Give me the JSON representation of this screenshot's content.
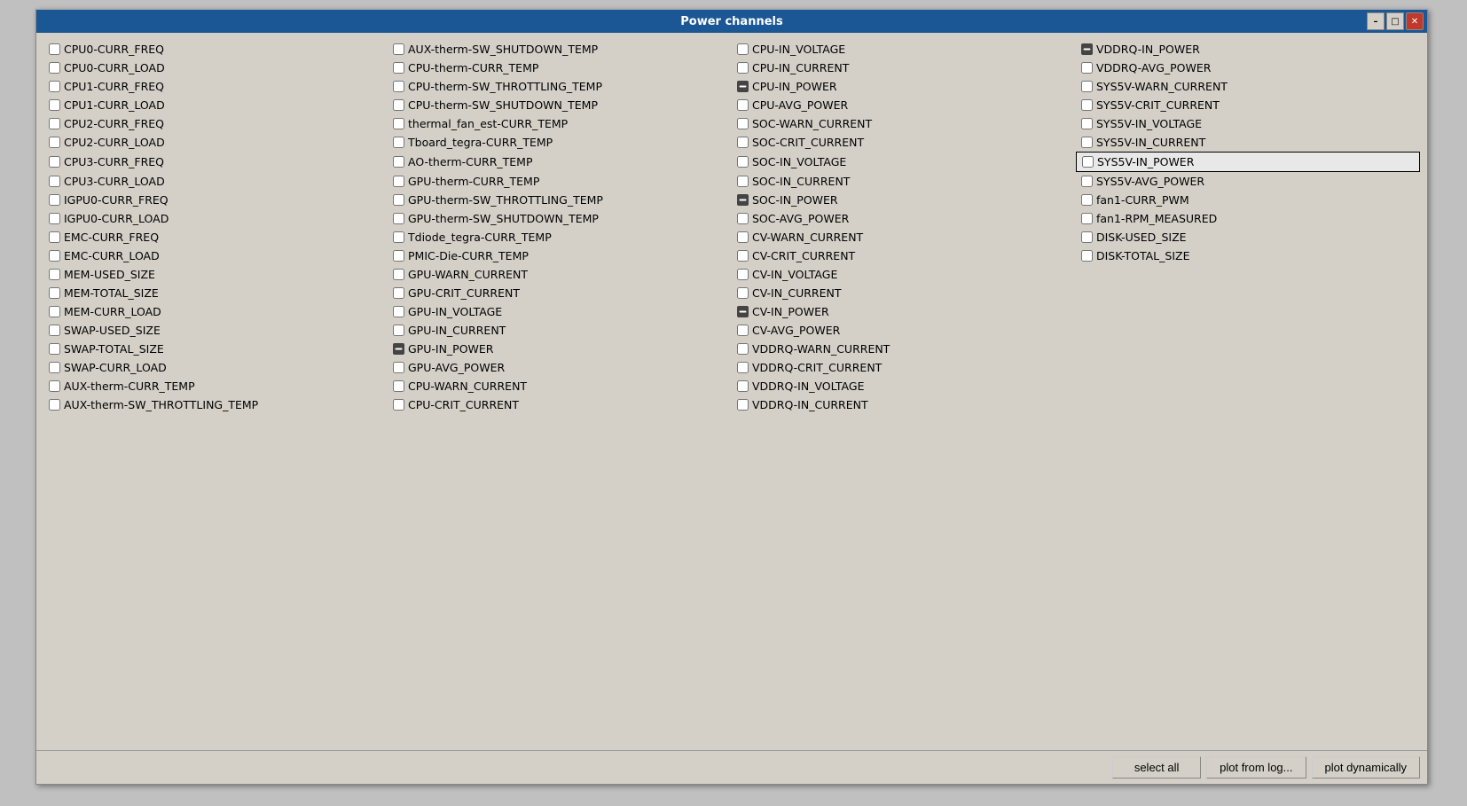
{
  "window": {
    "title": "Power channels",
    "titlebar_buttons": {
      "minimize": "–",
      "maximize": "□",
      "close": "✕"
    }
  },
  "buttons": {
    "select_all": "select all",
    "plot_from_log": "plot from log...",
    "plot_dynamically": "plot dynamically"
  },
  "columns": [
    [
      {
        "label": "CPU0-CURR_FREQ",
        "checked": false,
        "filled": false,
        "selected": false
      },
      {
        "label": "CPU0-CURR_LOAD",
        "checked": false,
        "filled": false,
        "selected": false
      },
      {
        "label": "CPU1-CURR_FREQ",
        "checked": false,
        "filled": false,
        "selected": false
      },
      {
        "label": "CPU1-CURR_LOAD",
        "checked": false,
        "filled": false,
        "selected": false
      },
      {
        "label": "CPU2-CURR_FREQ",
        "checked": false,
        "filled": false,
        "selected": false
      },
      {
        "label": "CPU2-CURR_LOAD",
        "checked": false,
        "filled": false,
        "selected": false
      },
      {
        "label": "CPU3-CURR_FREQ",
        "checked": false,
        "filled": false,
        "selected": false
      },
      {
        "label": "CPU3-CURR_LOAD",
        "checked": false,
        "filled": false,
        "selected": false
      },
      {
        "label": "IGPU0-CURR_FREQ",
        "checked": false,
        "filled": false,
        "selected": false
      },
      {
        "label": "IGPU0-CURR_LOAD",
        "checked": false,
        "filled": false,
        "selected": false
      },
      {
        "label": "EMC-CURR_FREQ",
        "checked": false,
        "filled": false,
        "selected": false
      },
      {
        "label": "EMC-CURR_LOAD",
        "checked": false,
        "filled": false,
        "selected": false
      },
      {
        "label": "MEM-USED_SIZE",
        "checked": false,
        "filled": false,
        "selected": false
      },
      {
        "label": "MEM-TOTAL_SIZE",
        "checked": false,
        "filled": false,
        "selected": false
      },
      {
        "label": "MEM-CURR_LOAD",
        "checked": false,
        "filled": false,
        "selected": false
      },
      {
        "label": "SWAP-USED_SIZE",
        "checked": false,
        "filled": false,
        "selected": false
      },
      {
        "label": "SWAP-TOTAL_SIZE",
        "checked": false,
        "filled": false,
        "selected": false
      },
      {
        "label": "SWAP-CURR_LOAD",
        "checked": false,
        "filled": false,
        "selected": false
      },
      {
        "label": "AUX-therm-CURR_TEMP",
        "checked": false,
        "filled": false,
        "selected": false
      },
      {
        "label": "AUX-therm-SW_THROTTLING_TEMP",
        "checked": false,
        "filled": false,
        "selected": false
      }
    ],
    [
      {
        "label": "AUX-therm-SW_SHUTDOWN_TEMP",
        "checked": false,
        "filled": false,
        "selected": false
      },
      {
        "label": "CPU-therm-CURR_TEMP",
        "checked": false,
        "filled": false,
        "selected": false
      },
      {
        "label": "CPU-therm-SW_THROTTLING_TEMP",
        "checked": false,
        "filled": false,
        "selected": false
      },
      {
        "label": "CPU-therm-SW_SHUTDOWN_TEMP",
        "checked": false,
        "filled": false,
        "selected": false
      },
      {
        "label": "thermal_fan_est-CURR_TEMP",
        "checked": false,
        "filled": false,
        "selected": false
      },
      {
        "label": "Tboard_tegra-CURR_TEMP",
        "checked": false,
        "filled": false,
        "selected": false
      },
      {
        "label": "AO-therm-CURR_TEMP",
        "checked": false,
        "filled": false,
        "selected": false
      },
      {
        "label": "GPU-therm-CURR_TEMP",
        "checked": false,
        "filled": false,
        "selected": false
      },
      {
        "label": "GPU-therm-SW_THROTTLING_TEMP",
        "checked": false,
        "filled": false,
        "selected": false
      },
      {
        "label": "GPU-therm-SW_SHUTDOWN_TEMP",
        "checked": false,
        "filled": false,
        "selected": false
      },
      {
        "label": "Tdiode_tegra-CURR_TEMP",
        "checked": false,
        "filled": false,
        "selected": false
      },
      {
        "label": "PMIC-Die-CURR_TEMP",
        "checked": false,
        "filled": false,
        "selected": false
      },
      {
        "label": "GPU-WARN_CURRENT",
        "checked": false,
        "filled": false,
        "selected": false
      },
      {
        "label": "GPU-CRIT_CURRENT",
        "checked": false,
        "filled": false,
        "selected": false
      },
      {
        "label": "GPU-IN_VOLTAGE",
        "checked": false,
        "filled": false,
        "selected": false
      },
      {
        "label": "GPU-IN_CURRENT",
        "checked": false,
        "filled": false,
        "selected": false
      },
      {
        "label": "GPU-IN_POWER",
        "checked": false,
        "filled": true,
        "selected": false
      },
      {
        "label": "GPU-AVG_POWER",
        "checked": false,
        "filled": false,
        "selected": false
      },
      {
        "label": "CPU-WARN_CURRENT",
        "checked": false,
        "filled": false,
        "selected": false
      },
      {
        "label": "CPU-CRIT_CURRENT",
        "checked": false,
        "filled": false,
        "selected": false
      }
    ],
    [
      {
        "label": "CPU-IN_VOLTAGE",
        "checked": false,
        "filled": false,
        "selected": false
      },
      {
        "label": "CPU-IN_CURRENT",
        "checked": false,
        "filled": false,
        "selected": false
      },
      {
        "label": "CPU-IN_POWER",
        "checked": false,
        "filled": true,
        "selected": false
      },
      {
        "label": "CPU-AVG_POWER",
        "checked": false,
        "filled": false,
        "selected": false
      },
      {
        "label": "SOC-WARN_CURRENT",
        "checked": false,
        "filled": false,
        "selected": false
      },
      {
        "label": "SOC-CRIT_CURRENT",
        "checked": false,
        "filled": false,
        "selected": false
      },
      {
        "label": "SOC-IN_VOLTAGE",
        "checked": false,
        "filled": false,
        "selected": false
      },
      {
        "label": "SOC-IN_CURRENT",
        "checked": false,
        "filled": false,
        "selected": false
      },
      {
        "label": "SOC-IN_POWER",
        "checked": false,
        "filled": true,
        "selected": false
      },
      {
        "label": "SOC-AVG_POWER",
        "checked": false,
        "filled": false,
        "selected": false
      },
      {
        "label": "CV-WARN_CURRENT",
        "checked": false,
        "filled": false,
        "selected": false
      },
      {
        "label": "CV-CRIT_CURRENT",
        "checked": false,
        "filled": false,
        "selected": false
      },
      {
        "label": "CV-IN_VOLTAGE",
        "checked": false,
        "filled": false,
        "selected": false
      },
      {
        "label": "CV-IN_CURRENT",
        "checked": false,
        "filled": false,
        "selected": false
      },
      {
        "label": "CV-IN_POWER",
        "checked": false,
        "filled": true,
        "selected": false
      },
      {
        "label": "CV-AVG_POWER",
        "checked": false,
        "filled": false,
        "selected": false
      },
      {
        "label": "VDDRQ-WARN_CURRENT",
        "checked": false,
        "filled": false,
        "selected": false
      },
      {
        "label": "VDDRQ-CRIT_CURRENT",
        "checked": false,
        "filled": false,
        "selected": false
      },
      {
        "label": "VDDRQ-IN_VOLTAGE",
        "checked": false,
        "filled": false,
        "selected": false
      },
      {
        "label": "VDDRQ-IN_CURRENT",
        "checked": false,
        "filled": false,
        "selected": false
      }
    ],
    [
      {
        "label": "VDDRQ-IN_POWER",
        "checked": false,
        "filled": true,
        "selected": false
      },
      {
        "label": "VDDRQ-AVG_POWER",
        "checked": false,
        "filled": false,
        "selected": false
      },
      {
        "label": "SYS5V-WARN_CURRENT",
        "checked": false,
        "filled": false,
        "selected": false
      },
      {
        "label": "SYS5V-CRIT_CURRENT",
        "checked": false,
        "filled": false,
        "selected": false
      },
      {
        "label": "SYS5V-IN_VOLTAGE",
        "checked": false,
        "filled": false,
        "selected": false
      },
      {
        "label": "SYS5V-IN_CURRENT",
        "checked": false,
        "filled": false,
        "selected": false
      },
      {
        "label": "SYS5V-IN_POWER",
        "checked": false,
        "filled": false,
        "selected": true
      },
      {
        "label": "SYS5V-AVG_POWER",
        "checked": false,
        "filled": false,
        "selected": false
      },
      {
        "label": "fan1-CURR_PWM",
        "checked": false,
        "filled": false,
        "selected": false
      },
      {
        "label": "fan1-RPM_MEASURED",
        "checked": false,
        "filled": false,
        "selected": false
      },
      {
        "label": "DISK-USED_SIZE",
        "checked": false,
        "filled": false,
        "selected": false
      },
      {
        "label": "DISK-TOTAL_SIZE",
        "checked": false,
        "filled": false,
        "selected": false
      }
    ]
  ]
}
